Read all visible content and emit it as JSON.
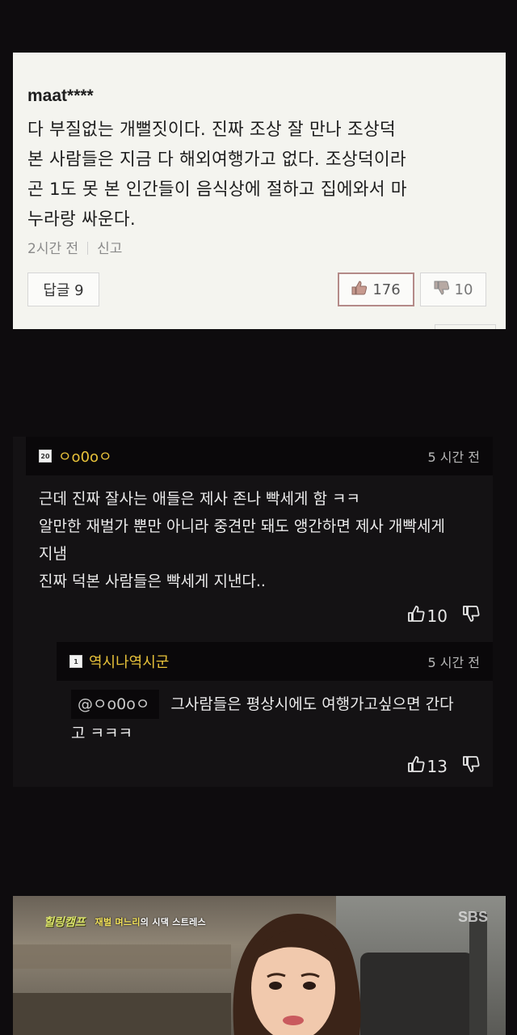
{
  "comment_top": {
    "author": "maat****",
    "lines": [
      "다 부질없는 개뻘짓이다. 진짜 조상 잘 만나 조상덕",
      "본 사람들은 지금 다 해외여행가고 없다. 조상덕이라",
      "곤 1도 못 본 인간들이 음식상에 절하고 집에와서 마",
      "누라랑 싸운다."
    ],
    "time": "2시간 전",
    "report": "신고",
    "reply_label": "답글 9",
    "likes": "176",
    "dislikes": "10"
  },
  "thread": {
    "comment": {
      "badge": "20",
      "username": "ㅇo0oㅇ",
      "time": "5 시간 전",
      "lines": [
        "근데 진짜 잘사는 애들은 제사 존나 빡세게 함 ㅋㅋ",
        "알만한 재벌가 뿐만 아니라 중견만 돼도 앵간하면 제사 개빡세게",
        "지냄",
        "진짜 덕본 사람들은 빡세게 지낸다.."
      ],
      "likes": "10"
    },
    "reply": {
      "badge": "1",
      "username": "역시나역시군",
      "time": "5 시간 전",
      "mention": "@ㅇo0oㅇ",
      "text_line1": "그사람들은 평상시에도 여행가고싶으면 간다",
      "text_line2": "고 ㅋㅋㅋ",
      "likes": "13"
    }
  },
  "video": {
    "show_logo": "힐링캠프",
    "caption_highlight": "재벌 며느리",
    "caption_rest": "의 시댁 스트레스",
    "channel": "SBS"
  },
  "colors": {
    "page_bg": "#0e0c0e",
    "card_bg": "#f4f4ef",
    "username": "#e8c23a",
    "like_border": "#b48a88"
  },
  "icons": [
    "thumbs-up-icon",
    "thumbs-down-icon"
  ]
}
